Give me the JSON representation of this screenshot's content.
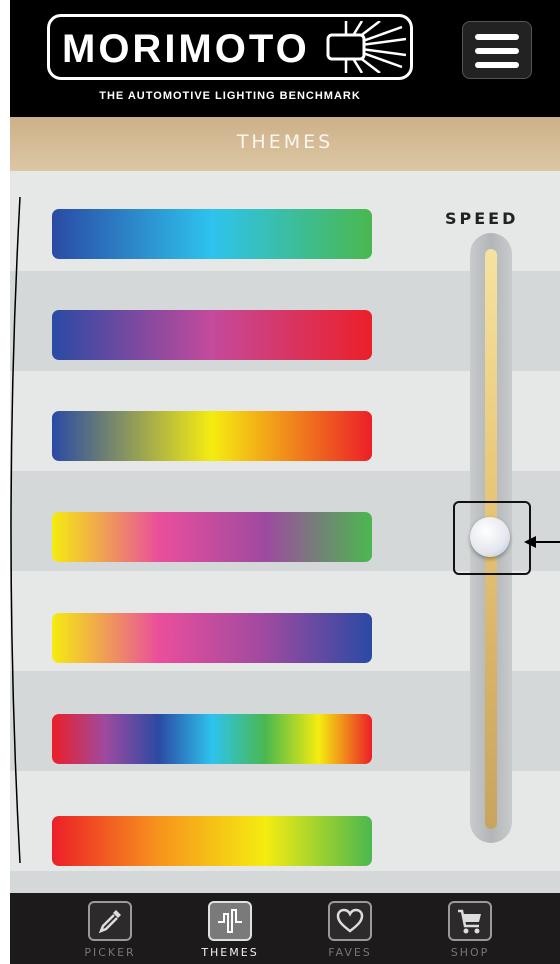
{
  "brand": {
    "name": "MORIMOTO",
    "tagline": "THE AUTOMOTIVE LIGHTING BENCHMARK"
  },
  "header": {
    "title": "THEMES"
  },
  "themes": [
    {
      "colors": [
        "#2a4aa4",
        "#2ec3ee",
        "#4ab84e"
      ]
    },
    {
      "colors": [
        "#2a4aa4",
        "#c44a9c",
        "#ec1f28"
      ]
    },
    {
      "colors": [
        "#2a4aa4",
        "#f5ec10",
        "#ec1f28"
      ]
    },
    {
      "colors": [
        "#f5ec10",
        "#ea4e9c",
        "#9e4aa0",
        "#4ab84e"
      ]
    },
    {
      "colors": [
        "#f5ec10",
        "#ea4e9c",
        "#9e4aa0",
        "#2a4aa4"
      ]
    },
    {
      "colors": [
        "#ec1f28",
        "#9e4aa0",
        "#2a4aa4",
        "#2ec3ee",
        "#4ab84e",
        "#f5ec10",
        "#ec1f28"
      ]
    },
    {
      "colors": [
        "#ec1f28",
        "#f7941d",
        "#f5ec10",
        "#4ab84e"
      ]
    }
  ],
  "speed": {
    "label": "SPEED",
    "value": 0.5
  },
  "nav": [
    {
      "label": "PICKER",
      "icon": "eyedropper-icon",
      "active": false
    },
    {
      "label": "THEMES",
      "icon": "waveform-icon",
      "active": true
    },
    {
      "label": "FAVES",
      "icon": "heart-icon",
      "active": false
    },
    {
      "label": "SHOP",
      "icon": "cart-icon",
      "active": false
    }
  ]
}
